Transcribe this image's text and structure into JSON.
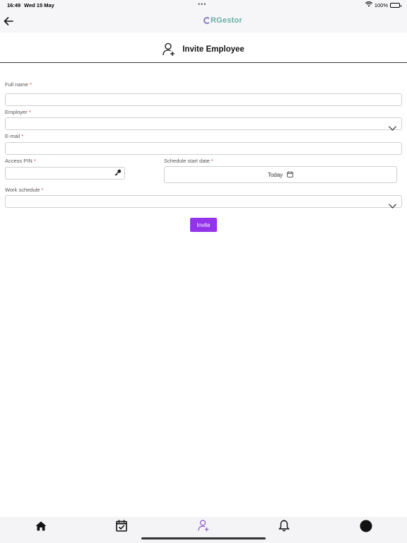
{
  "status_bar": {
    "time": "16:49",
    "date": "Wed 15 May",
    "dots": "•••",
    "battery": "100%"
  },
  "header": {
    "logo_text": "RGestor",
    "back_icon": "arrow-left-icon",
    "logo_color": "#6ab0a8",
    "logo_mark_color": "#8a7cc7"
  },
  "page": {
    "title": "Invite Employee",
    "title_icon": "user-plus-icon"
  },
  "form": {
    "required_mark": "*",
    "full_name": {
      "label": "Full name",
      "value": ""
    },
    "employer": {
      "label": "Employer",
      "value": ""
    },
    "email": {
      "label": "E-mail",
      "value": ""
    },
    "access_pin": {
      "label": "Access PIN",
      "value": "",
      "icon": "key-icon"
    },
    "schedule_start_date": {
      "label": "Schedule start date",
      "value": "Today",
      "icon": "calendar-icon"
    },
    "work_schedule": {
      "label": "Work schedule",
      "value": ""
    },
    "invite_label": "Invite",
    "accent_color": "#9333ea"
  },
  "bottom_nav": [
    {
      "name": "home",
      "icon": "home-icon"
    },
    {
      "name": "schedule",
      "icon": "calendar-check-icon"
    },
    {
      "name": "invite",
      "icon": "user-plus-icon",
      "active": true
    },
    {
      "name": "notifications",
      "icon": "bell-icon"
    },
    {
      "name": "profile",
      "icon": "avatar-icon"
    }
  ]
}
